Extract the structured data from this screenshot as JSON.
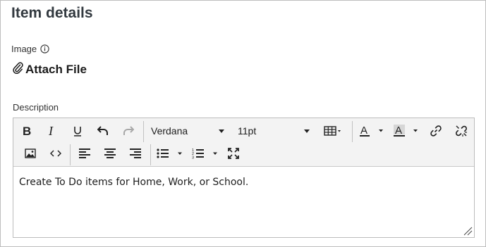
{
  "panel": {
    "title": "Item details"
  },
  "image_field": {
    "label": "Image",
    "info_icon": "info-icon"
  },
  "attach": {
    "label": "Attach File",
    "icon": "paperclip-icon"
  },
  "description": {
    "label": "Description",
    "content": "Create To Do items for Home, Work, or School."
  },
  "toolbar": {
    "font_family": "Verdana",
    "font_size": "11pt",
    "buttons": [
      "bold-icon",
      "italic-icon",
      "underline-icon",
      "undo-icon",
      "redo-icon",
      "table-icon",
      "text-color-icon",
      "highlight-color-icon",
      "link-icon",
      "unlink-icon",
      "image-icon",
      "code-icon",
      "align-left-icon",
      "align-center-icon",
      "align-right-icon",
      "bullet-list-icon",
      "numbered-list-icon",
      "fullscreen-icon"
    ]
  }
}
